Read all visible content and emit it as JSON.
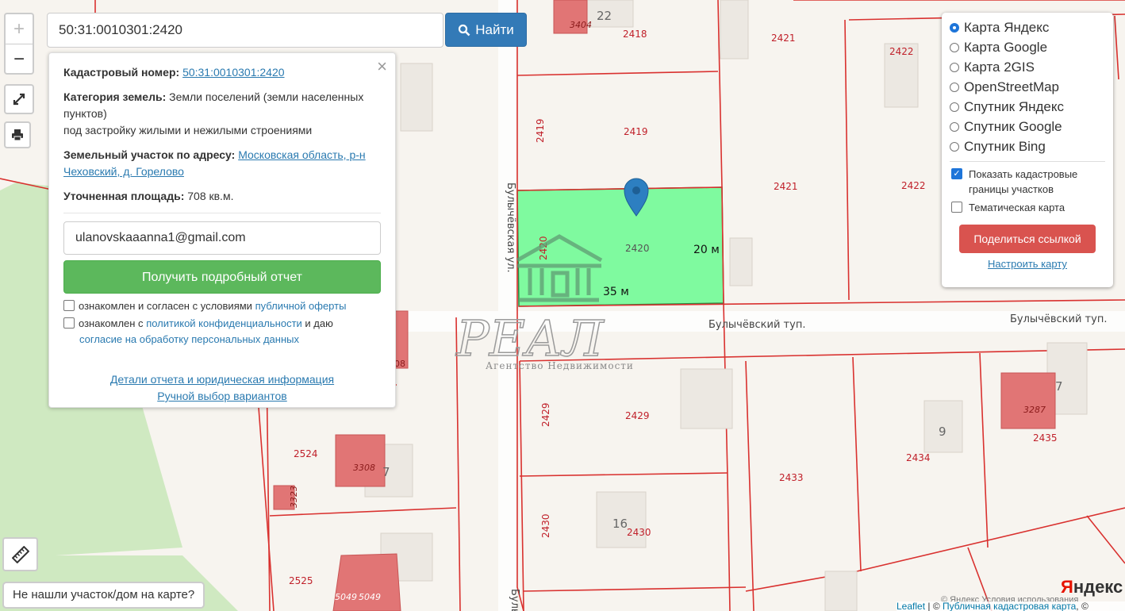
{
  "zoom": {
    "in_label": "+",
    "out_label": "−"
  },
  "search": {
    "value": "50:31:0010301:2420",
    "button_label": "Найти"
  },
  "panel": {
    "cadastral_label": "Кадастровый номер:",
    "cadastral_value": "50:31:0010301:2420",
    "category_label": "Категория земель:",
    "category_value": "Земли поселений (земли населенных пунктов)",
    "category_sub": "под застройку жилыми и нежилыми строениями",
    "address_label": "Земельный участок по адресу:",
    "address_value": "Московская область, р-н Чеховский, д. Горелово",
    "area_label": "Уточненная площадь:",
    "area_value": "708 кв.м.",
    "email_value": "ulanovskaaanna1@gmail.com",
    "report_button": "Получить подробный отчет",
    "offer_text": "ознакомлен и согласен с условиями ",
    "offer_link": "публичной оферты",
    "privacy_text": "ознакомлен с ",
    "privacy_link": "политикой конфиденциальности",
    "privacy_and": " и даю",
    "consent_link": "согласие на обработку персональных данных",
    "details_link": "Детали отчета и юридическая информация",
    "manual_link": "Ручной выбор вариантов",
    "close_glyph": "×"
  },
  "layers": {
    "options": [
      "Карта Яндекс",
      "Карта Google",
      "Карта 2GIS",
      "OpenStreetMap",
      "Спутник Яндекс",
      "Спутник Google",
      "Спутник Bing"
    ],
    "show_cadastral": "Показать кадастровые границы участков",
    "thematic": "Тематическая карта",
    "share_button": "Поделиться ссылкой",
    "tune_link": "Настроить карту"
  },
  "map": {
    "plots": [
      "2418",
      "2419",
      "2419",
      "2420",
      "2420",
      "2421",
      "2421",
      "2422",
      "2422",
      "2429",
      "2429",
      "2430",
      "2430",
      "2433",
      "2434",
      "2435",
      "2524",
      "2525"
    ],
    "buildings": [
      "3404",
      "3308",
      "3323",
      "3287",
      "5049",
      "5049",
      "16",
      "9",
      "7",
      "7",
      "22",
      "08"
    ],
    "streets": [
      "Булычёвская ул.",
      "Булычёвский туп.",
      "Булычёвский туп.",
      "Булы"
    ],
    "dim_width": "20 м",
    "dim_length": "35 м",
    "watermark_title": "РЕАЛ",
    "watermark_sub": "Агентство Недвижимости"
  },
  "bottom": {
    "not_found": "Не нашли участок/дом на карте?",
    "leaflet": "Leaflet",
    "sep": " | © ",
    "pkk": "Публичная кадастровая карта",
    "tail": ", ©",
    "copyright": "© Яндекс  Условия использования",
    "yandex_y": "Я",
    "yandex_rest": "ндекс"
  },
  "colors": {
    "selected_plot": "#7ffa9f",
    "boundary": "#d9312f",
    "primary": "#337ab7",
    "success": "#5cb85c",
    "danger": "#d9534f"
  },
  "icons": [
    "plus-icon",
    "minus-icon",
    "fullscreen-icon",
    "print-icon",
    "search-icon",
    "map-marker-icon",
    "ruler-icon",
    "close-icon"
  ]
}
